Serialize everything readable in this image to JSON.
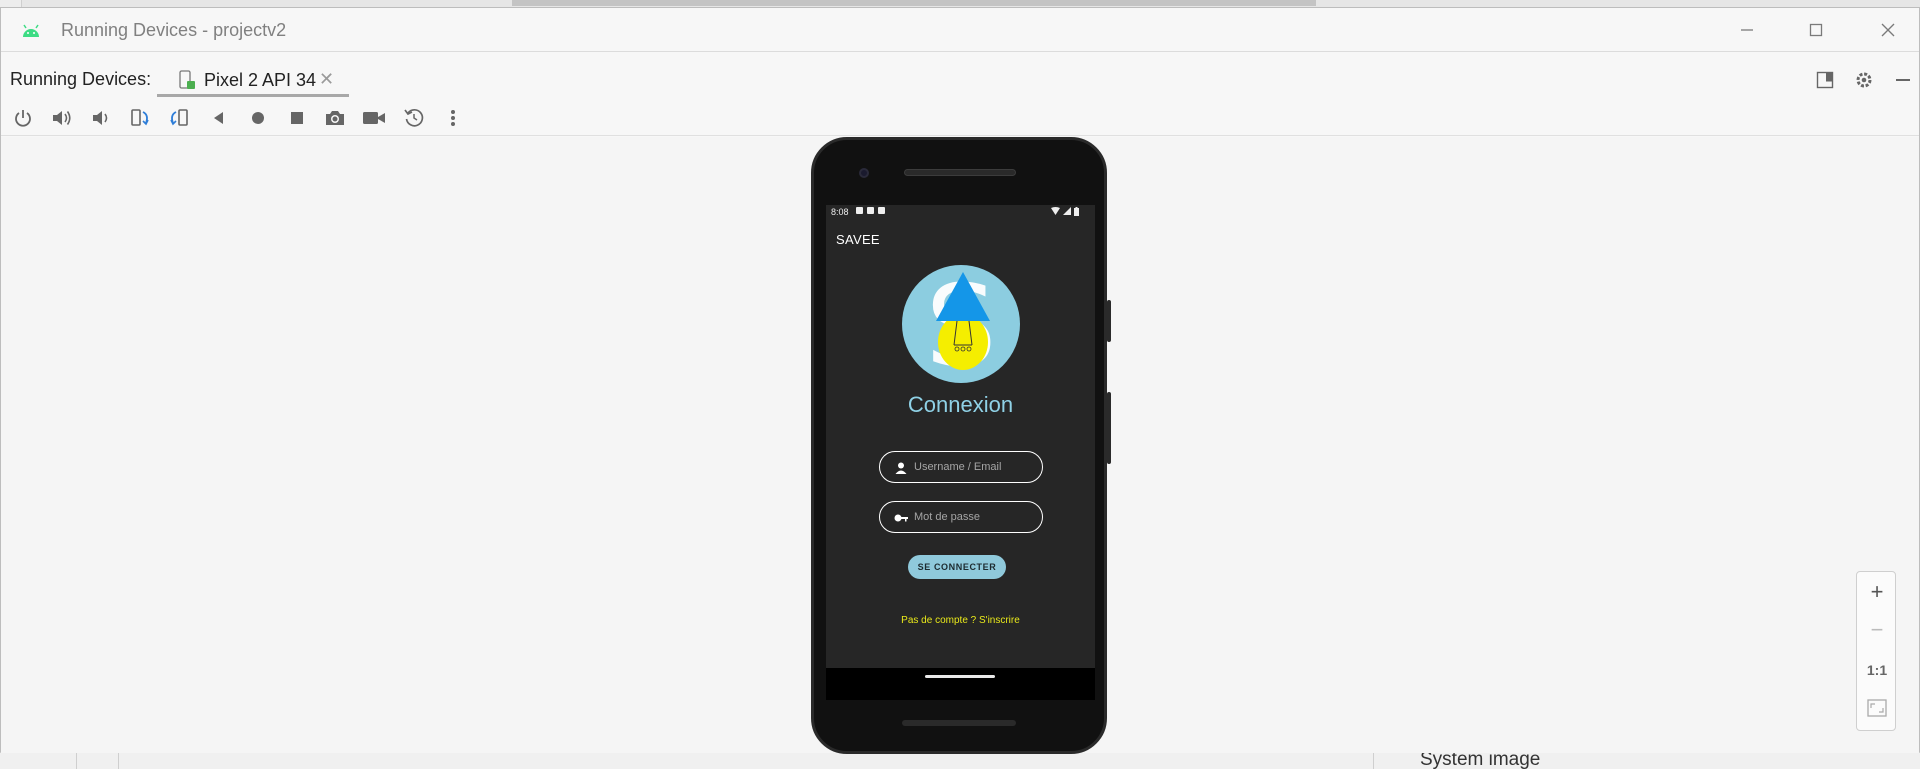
{
  "window": {
    "title": "Running Devices - projectv2",
    "app_icon": "android-icon",
    "controls": [
      "minimize-icon",
      "maximize-icon",
      "close-icon"
    ]
  },
  "tabbar": {
    "label": "Running Devices:",
    "tab_label": "Pixel 2 API 34",
    "tab_icon": "device-icon",
    "right_tools": [
      "layout-icon",
      "gear-icon",
      "minimize-panel-icon"
    ]
  },
  "toolbar": {
    "buttons": [
      "power-icon",
      "volume-up-icon",
      "volume-down-icon",
      "rotate-left-icon",
      "rotate-right-icon",
      "back-icon",
      "home-icon",
      "overview-icon",
      "screenshot-icon",
      "screen-record-icon",
      "reset-icon",
      "more-icon"
    ]
  },
  "device": {
    "status_time": "8:08",
    "app_title": "SAVEE",
    "heading": "Connexion",
    "username_placeholder": "Username / Email",
    "password_placeholder": "Mot de passe",
    "login_button": "SE CONNECTER",
    "signup_link": "Pas de compte ? S'inscrire"
  },
  "zoom": {
    "zoom_in": "+",
    "zoom_out": "−",
    "actual_size": "1:1"
  },
  "background": {
    "bottom_text": "System image"
  },
  "colors": {
    "accent_blue": "#8fd1e6",
    "button_bg": "#8fc9db",
    "link_yellow": "#e8e81a",
    "android_green": "#3ddc84"
  }
}
